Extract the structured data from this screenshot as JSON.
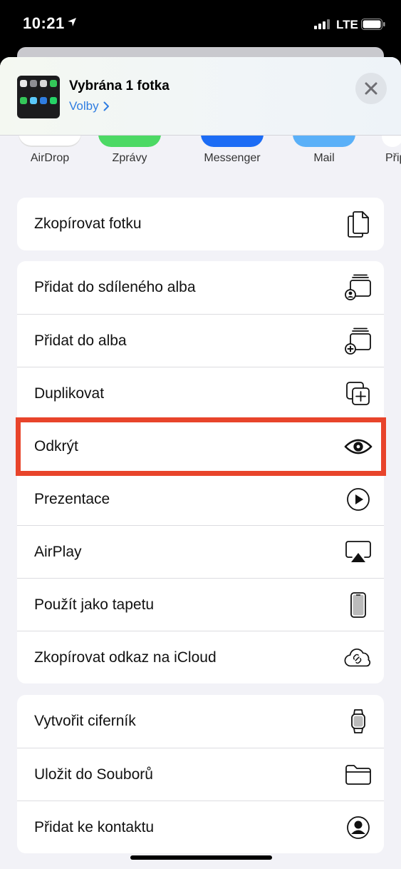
{
  "status": {
    "time": "10:21",
    "network": "LTE"
  },
  "header": {
    "title": "Vybrána 1 fotka",
    "options": "Volby"
  },
  "apps": [
    {
      "label": "AirDrop",
      "icon": "airdrop-icon",
      "color": "#3b8ff0"
    },
    {
      "label": "Zprávy",
      "icon": "messages-icon",
      "color": "#4cd964"
    },
    {
      "label": "Messenger",
      "icon": "messenger-icon",
      "color": "#1c6cf5"
    },
    {
      "label": "Mail",
      "icon": "mail-icon",
      "color": "#5ab0f8"
    },
    {
      "label": "Přip",
      "icon": "reminders-icon",
      "color": "#f39c3a"
    }
  ],
  "groups": [
    {
      "items": [
        {
          "label": "Zkopírovat fotku",
          "icon": "copy-icon"
        }
      ]
    },
    {
      "items": [
        {
          "label": "Přidat do sdíleného alba",
          "icon": "shared-album-icon"
        },
        {
          "label": "Přidat do alba",
          "icon": "add-album-icon"
        },
        {
          "label": "Duplikovat",
          "icon": "duplicate-icon"
        },
        {
          "label": "Odkrýt",
          "icon": "eye-icon",
          "highlighted": true
        },
        {
          "label": "Prezentace",
          "icon": "play-icon"
        },
        {
          "label": "AirPlay",
          "icon": "airplay-icon"
        },
        {
          "label": "Použít jako tapetu",
          "icon": "phone-icon"
        },
        {
          "label": "Zkopírovat odkaz na iCloud",
          "icon": "cloud-link-icon"
        }
      ]
    },
    {
      "items": [
        {
          "label": "Vytvořit ciferník",
          "icon": "watch-icon"
        },
        {
          "label": "Uložit do Souborů",
          "icon": "folder-icon"
        },
        {
          "label": "Přidat ke kontaktu",
          "icon": "contact-icon"
        }
      ]
    }
  ],
  "colors": {
    "accent": "#2f7de1",
    "highlight": "#e8442b"
  }
}
